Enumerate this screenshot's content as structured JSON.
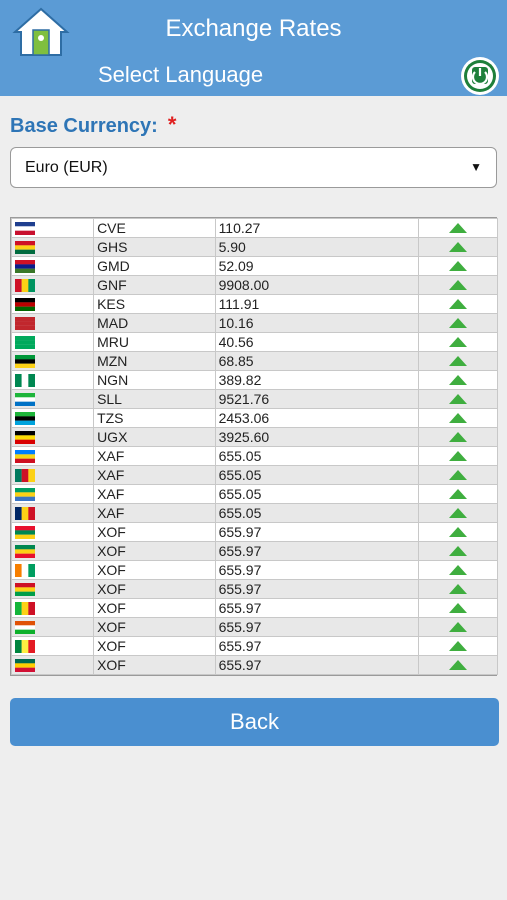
{
  "header": {
    "title": "Exchange Rates",
    "language_label": "Select Language"
  },
  "base": {
    "label": "Base Currency:",
    "required_mark": "*",
    "selected": "Euro (EUR)"
  },
  "rates": [
    {
      "code": "CVE",
      "rate": "110.27",
      "flag": [
        "#1f3f8f",
        "#ffffff",
        "#c8102e"
      ]
    },
    {
      "code": "GHS",
      "rate": "5.90",
      "flag": [
        "#ce1126",
        "#fcd116",
        "#006b3f"
      ]
    },
    {
      "code": "GMD",
      "rate": "52.09",
      "flag": [
        "#ce1126",
        "#0c1c8c",
        "#3a7728"
      ]
    },
    {
      "code": "GNF",
      "rate": "9908.00",
      "flag": [
        "#ce1126",
        "#fcd116",
        "#009460"
      ],
      "vertical": true
    },
    {
      "code": "KES",
      "rate": "111.91",
      "flag": [
        "#000000",
        "#bb0000",
        "#006600"
      ]
    },
    {
      "code": "MAD",
      "rate": "10.16",
      "flag": [
        "#c1272d",
        "#c1272d",
        "#c1272d"
      ]
    },
    {
      "code": "MRU",
      "rate": "40.56",
      "flag": [
        "#00a95c",
        "#00a95c",
        "#00a95c"
      ]
    },
    {
      "code": "MZN",
      "rate": "68.85",
      "flag": [
        "#009739",
        "#000000",
        "#fcd116"
      ]
    },
    {
      "code": "NGN",
      "rate": "389.82",
      "flag": [
        "#008751",
        "#ffffff",
        "#008751"
      ],
      "vertical": true
    },
    {
      "code": "SLL",
      "rate": "9521.76",
      "flag": [
        "#1eb53a",
        "#ffffff",
        "#0072c6"
      ]
    },
    {
      "code": "TZS",
      "rate": "2453.06",
      "flag": [
        "#1eb53a",
        "#000000",
        "#00a3dd"
      ]
    },
    {
      "code": "UGX",
      "rate": "3925.60",
      "flag": [
        "#000000",
        "#fcdc04",
        "#d90000"
      ]
    },
    {
      "code": "XAF",
      "rate": "655.05",
      "flag": [
        "#007fff",
        "#f7d618",
        "#ce1021"
      ]
    },
    {
      "code": "XAF",
      "rate": "655.05",
      "flag": [
        "#007a5e",
        "#ce1126",
        "#fcd116"
      ],
      "vertical": true
    },
    {
      "code": "XAF",
      "rate": "655.05",
      "flag": [
        "#009e60",
        "#fcd116",
        "#3a75c4"
      ]
    },
    {
      "code": "XAF",
      "rate": "655.05",
      "flag": [
        "#002664",
        "#fcd116",
        "#ce1126"
      ],
      "vertical": true
    },
    {
      "code": "XOF",
      "rate": "655.97",
      "flag": [
        "#e8112d",
        "#008751",
        "#fcd116"
      ]
    },
    {
      "code": "XOF",
      "rate": "655.97",
      "flag": [
        "#008751",
        "#fcd116",
        "#e8112d"
      ]
    },
    {
      "code": "XOF",
      "rate": "655.97",
      "flag": [
        "#f77f00",
        "#ffffff",
        "#009e60"
      ],
      "vertical": true
    },
    {
      "code": "XOF",
      "rate": "655.97",
      "flag": [
        "#ce1126",
        "#fcd116",
        "#009e49"
      ]
    },
    {
      "code": "XOF",
      "rate": "655.97",
      "flag": [
        "#14b53a",
        "#fcd116",
        "#ce1126"
      ],
      "vertical": true
    },
    {
      "code": "XOF",
      "rate": "655.97",
      "flag": [
        "#e05206",
        "#ffffff",
        "#0db02b"
      ]
    },
    {
      "code": "XOF",
      "rate": "655.97",
      "flag": [
        "#00853f",
        "#fdef42",
        "#e31b23"
      ],
      "vertical": true
    },
    {
      "code": "XOF",
      "rate": "655.97",
      "flag": [
        "#006a4e",
        "#ffce00",
        "#d21034"
      ]
    }
  ],
  "back_label": "Back"
}
